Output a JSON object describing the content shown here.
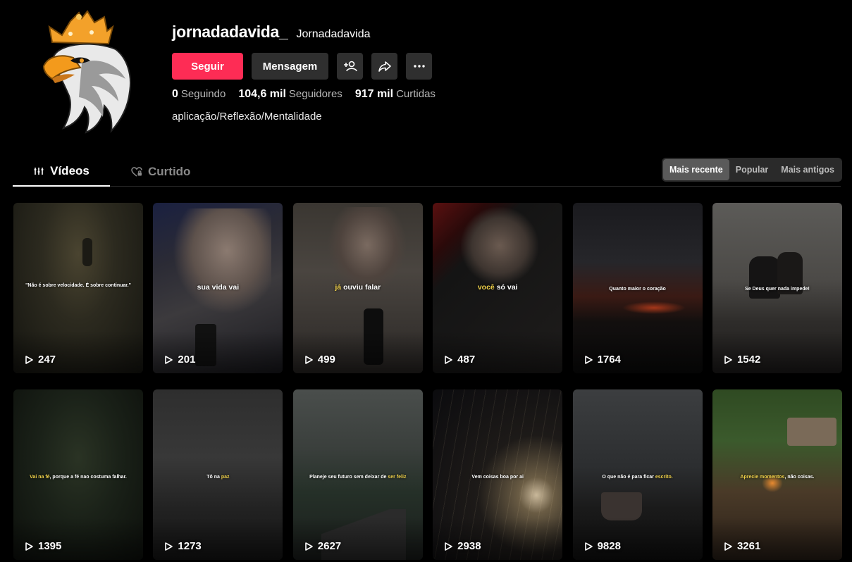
{
  "profile": {
    "username": "jornadadavida_",
    "nickname": "Jornadadavida",
    "follow_label": "Seguir",
    "message_label": "Mensagem",
    "bio": "aplicação/Reflexão/Mentalidade",
    "stats": [
      {
        "value": "0",
        "label": "Seguindo"
      },
      {
        "value": "104,6 mil",
        "label": "Seguidores"
      },
      {
        "value": "917 mil",
        "label": "Curtidas"
      }
    ]
  },
  "tabs": [
    {
      "label": "Vídeos",
      "icon": "grid-bars-icon",
      "active": true
    },
    {
      "label": "Curtido",
      "icon": "heart-lock-icon",
      "active": false
    }
  ],
  "sort_options": [
    {
      "label": "Mais recente",
      "active": true
    },
    {
      "label": "Popular",
      "active": false
    },
    {
      "label": "Mais antigos",
      "active": false
    }
  ],
  "videos": [
    {
      "views": "247",
      "caption": "\"Não é sobre velocidade. É sobre continuar.\"",
      "highlight": ""
    },
    {
      "views": "201",
      "caption": "sua vida vai",
      "highlight": ""
    },
    {
      "views": "499",
      "caption": "ouviu falar",
      "highlight": "já"
    },
    {
      "views": "487",
      "caption": "só vai",
      "highlight": "você"
    },
    {
      "views": "1764",
      "caption": "Quanto maior o coração",
      "highlight": ""
    },
    {
      "views": "1542",
      "caption": "Se Deus quer nada impede!",
      "highlight": ""
    },
    {
      "views": "1395",
      "caption": ", porque a fé nao costuma falhar.",
      "highlight": "Vai na fé"
    },
    {
      "views": "1273",
      "caption": "Tô na",
      "highlight": "paz"
    },
    {
      "views": "2627",
      "caption": "Planeje seu futuro sem deixar de",
      "highlight": "ser feliz"
    },
    {
      "views": "2938",
      "caption": "Vem coisas boa por ai",
      "highlight": ""
    },
    {
      "views": "9828",
      "caption": "O que não é para ficar",
      "highlight": "escrito."
    },
    {
      "views": "3261",
      "caption": ", não coisas.",
      "highlight": "Aprecie momentos"
    }
  ]
}
